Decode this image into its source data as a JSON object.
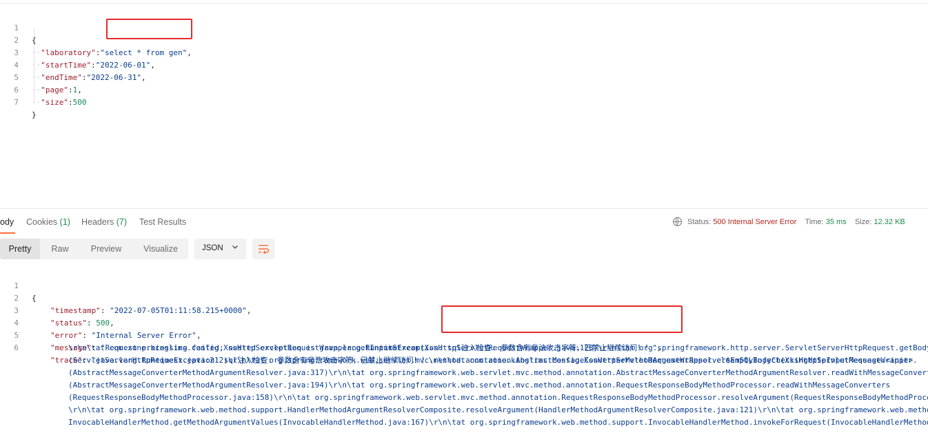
{
  "request_body": {
    "lines": [
      {
        "num": "1",
        "text": "{"
      },
      {
        "num": "2",
        "key": "\"laboratory\"",
        "value": "\"select * from gen\""
      },
      {
        "num": "3",
        "key": "\"startTime\"",
        "value": "\"2022-06-01\""
      },
      {
        "num": "4",
        "key": "\"endTime\"",
        "value": "\"2022-06-31\""
      },
      {
        "num": "5",
        "key": "\"page\"",
        "value": "1"
      },
      {
        "num": "6",
        "key": "\"size\"",
        "value": "500"
      },
      {
        "num": "7",
        "text": "}"
      }
    ]
  },
  "response_tabs": {
    "body": "ody",
    "cookies": "Cookies",
    "cookies_count": "(1)",
    "headers": "Headers",
    "headers_count": "(7)",
    "test_results": "Test Results"
  },
  "status_bar": {
    "status_label": "Status:",
    "status_value": "500 Internal Server Error",
    "time_label": "Time:",
    "time_value": "35 ms",
    "size_label": "Size:",
    "size_value": "12.32 KB"
  },
  "view_modes": [
    "Pretty",
    "Raw",
    "Preview",
    "Visualize"
  ],
  "format_dropdown": {
    "selected": "JSON"
  },
  "response_body": {
    "line_numbers": [
      "1",
      "2",
      "3",
      "4",
      "5",
      "6"
    ],
    "open_brace": "{",
    "timestamp_key": "\"timestamp\"",
    "timestamp_value": "\"2022-07-05T01:11:58.215+0000\"",
    "status_key": "\"status\"",
    "status_value": "500",
    "error_key": "\"error\"",
    "error_value": "\"Internal Server Error\"",
    "message_key": "\"message\"",
    "message_value": "\"Request processing failed; nested exception is java.lang.RuntimeException: sql注入检查: 参数含有非法攻击字符，已禁止继续访问！！\"",
    "trace_key": "\"trace\"",
    "trace_value": "\"java.lang.RuntimeException: sql注入检查: 参数含有非法攻击字符，已禁止继续访问！！\\r\\n\\tat com.zone.kinglims.config.XssHttpServletRequestWrapper.cleanSQLInject(XssHttpServletRequestWrapper.",
    "trace_continuation": [
      "\\r\\n\\tat com.zone.kinglims.config.XssHttpServletRequestWrapper.getInputStream(XssHttpServletRequestWrapper.java:128)\\r\\n\\tat org.springframework.http.server.ServletServerHttpRequest.getBody",
      "(ServletServerHttpRequest.java:212)\\r\\n\\tat org.springframework.web.servlet.mvc.method.annotation.AbstractMessageConverterMethodArgumentResolver$EmptyBodyCheckingHttpInputMessage.<init>",
      "(AbstractMessageConverterMethodArgumentResolver.java:317)\\r\\n\\tat org.springframework.web.servlet.mvc.method.annotation.AbstractMessageConverterMethodArgumentResolver.readWithMessageConvert",
      "(AbstractMessageConverterMethodArgumentResolver.java:194)\\r\\n\\tat org.springframework.web.servlet.mvc.method.annotation.RequestResponseBodyMethodProcessor.readWithMessageConverters",
      "(RequestResponseBodyMethodProcessor.java:158)\\r\\n\\tat org.springframework.web.servlet.mvc.method.annotation.RequestResponseBodyMethodProcessor.resolveArgument(RequestResponseBodyMethodProce",
      "\\r\\n\\tat org.springframework.web.method.support.HandlerMethodArgumentResolverComposite.resolveArgument(HandlerMethodArgumentResolverComposite.java:121)\\r\\n\\tat org.springframework.web.metho",
      "InvocableHandlerMethod.getMethodArgumentValues(InvocableHandlerMethod.java:167)\\r\\n\\tat org.springframework.web.method.support.InvocableHandlerMethod.invokeForRequest(InvocableHandlerMethod"
    ]
  },
  "colors": {
    "accent": "#ff6c37",
    "highlight_box": "#e52a2a",
    "json_key": "#9a1f2c",
    "json_string": "#0a3c8d",
    "json_number": "#158a5a",
    "status_error": "#b3261e"
  }
}
